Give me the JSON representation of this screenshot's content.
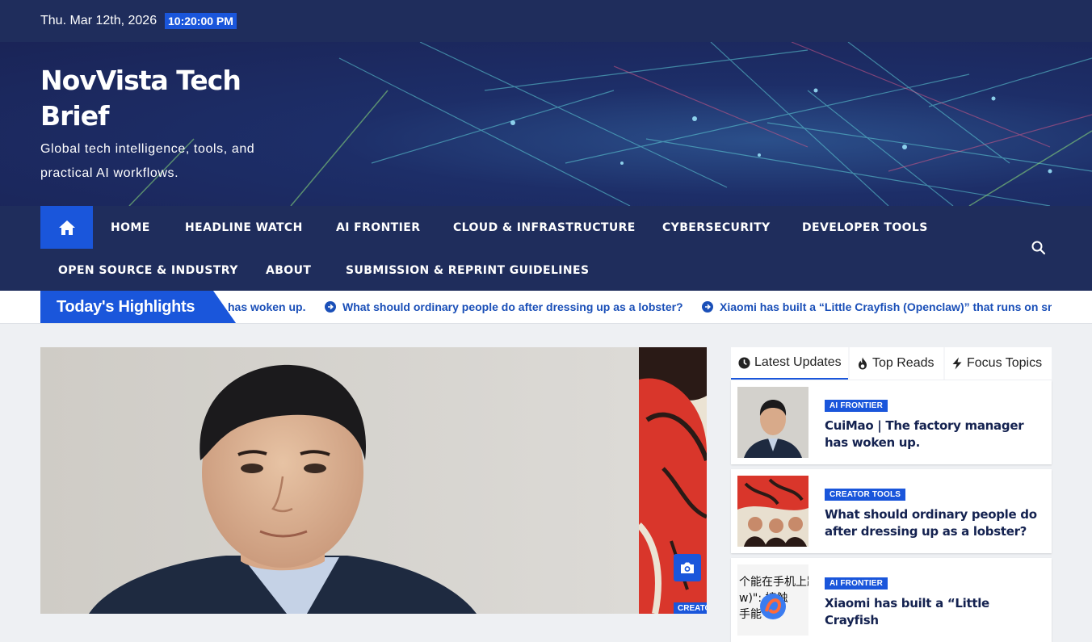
{
  "topbar": {
    "date": "Thu. Mar 12th, 2026",
    "time": "10:20:00 PM"
  },
  "site": {
    "title": "NovVista Tech Brief",
    "description": "Global tech intelligence, tools, and practical AI workflows."
  },
  "nav": {
    "row1": [
      "HOME",
      "HEADLINE WATCH",
      "AI FRONTIER",
      "CLOUD & INFRASTRUCTURE",
      "CYBERSECURITY",
      "DEVELOPER TOOLS"
    ],
    "row2": [
      "OPEN SOURCE & INDUSTRY",
      "ABOUT",
      "SUBMISSION & REPRINT GUIDELINES"
    ]
  },
  "ticker": {
    "label": "Today's Highlights",
    "items": [
      "has woken up.",
      "What should ordinary people do after dressing up as a lobster?",
      "Xiaomi has built a “Little Crayfish (Openclaw)” that runs on sm"
    ]
  },
  "hero": {
    "secondary_badge": "CREATOR TOOLS"
  },
  "sidebar": {
    "tabs": [
      "Latest Updates",
      "Top Reads",
      "Focus Topics"
    ],
    "posts": [
      {
        "category": "AI FRONTIER",
        "title": "CuiMao | The factory manager has woken up."
      },
      {
        "category": "CREATOR TOOLS",
        "title": "What should ordinary people do after dressing up as a lobster?"
      },
      {
        "category": "AI FRONTIER",
        "title": "Xiaomi has built a “Little Crayfish"
      }
    ],
    "thumb3_text": [
      "个能在手机上跑",
      "w)\": 接触",
      "手能"
    ]
  },
  "colors": {
    "navy": "#1f2d5c",
    "accent": "#1a56db"
  },
  "icons": {
    "home": "home-icon",
    "search": "search-icon",
    "arrow": "circle-arrow-right-icon",
    "camera": "camera-icon",
    "clock": "clock-icon",
    "fire": "fire-icon",
    "bolt": "bolt-icon"
  }
}
